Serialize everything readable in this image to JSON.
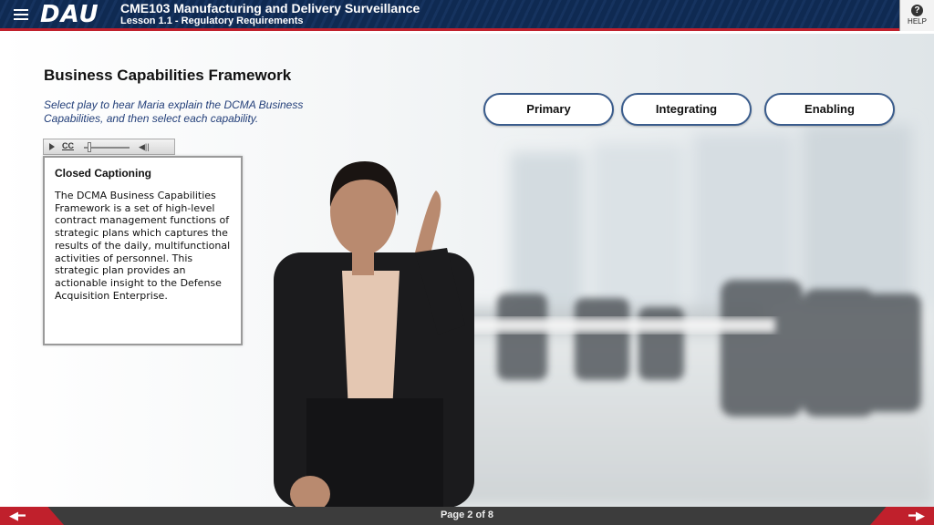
{
  "header": {
    "logo": "DAU",
    "course_title": "CME103 Manufacturing and Delivery Surveillance",
    "lesson_title": "Lesson 1.1 - Regulatory Requirements",
    "help_label": "HELP",
    "help_glyph": "?"
  },
  "main": {
    "heading": "Business Capabilities Framework",
    "instruction": "Select play to hear Maria explain the DCMA Business Capabilities, and then select each capability.",
    "capability_buttons": [
      "Primary",
      "Integrating",
      "Enabling"
    ]
  },
  "media": {
    "cc_label": "CC",
    "progress_percent": 0
  },
  "captions": {
    "title": "Closed Captioning",
    "text": "The DCMA Business Capabilities Framework is a set of high-level contract management functions of strategic plans which captures the results of the daily, multifunctional activities of personnel. This strategic plan provides an actionable insight to the Defense Acquisition Enterprise."
  },
  "footer": {
    "page_indicator": "Page 2 of 8",
    "prev_icon": "arrow-left-icon",
    "next_icon": "arrow-right-icon"
  },
  "colors": {
    "header_navy": "#0f2a52",
    "accent_red": "#c0202c",
    "button_border": "#3a5c8c",
    "instruction_blue": "#24407a",
    "footer_gray": "#3c3c3c"
  }
}
